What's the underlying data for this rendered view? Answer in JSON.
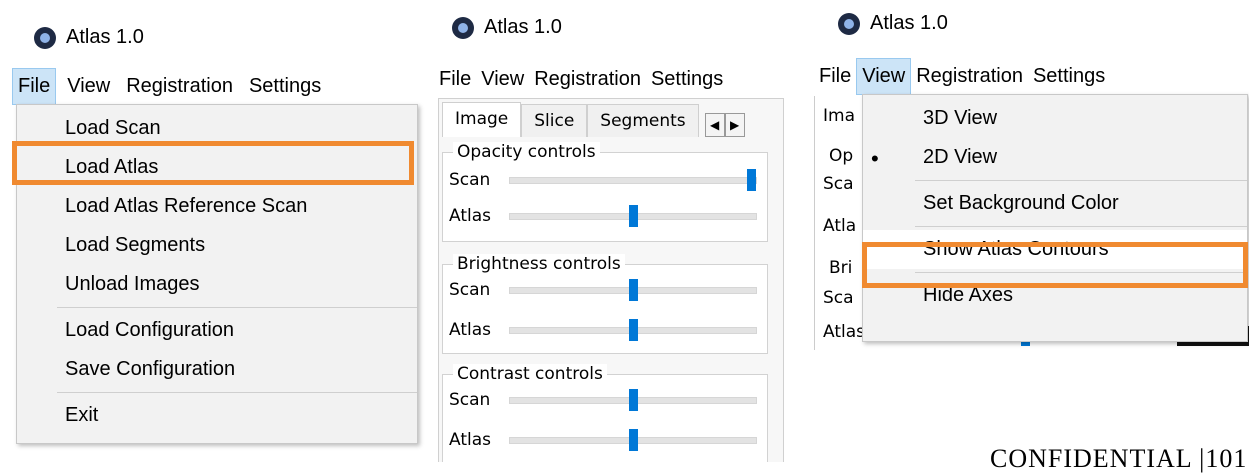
{
  "app_title": "Atlas 1.0",
  "menubar": [
    "File",
    "View",
    "Registration",
    "Settings"
  ],
  "file_menu": {
    "items": [
      "Load Scan",
      "Load Atlas",
      "Load Atlas Reference Scan",
      "Load Segments",
      "Unload Images",
      "Load Configuration",
      "Save Configuration",
      "Exit"
    ],
    "highlighted": "Load Atlas"
  },
  "tabs": [
    "Image",
    "Slice",
    "Segments"
  ],
  "tab_arrows": [
    "◀",
    "▶"
  ],
  "groups": [
    {
      "title": "Opacity controls",
      "rows": [
        {
          "label": "Scan",
          "value": 1.0
        },
        {
          "label": "Atlas",
          "value": 0.5
        }
      ]
    },
    {
      "title": "Brightness controls",
      "rows": [
        {
          "label": "Scan",
          "value": 0.5
        },
        {
          "label": "Atlas",
          "value": 0.5
        }
      ]
    },
    {
      "title": "Contrast controls",
      "rows": [
        {
          "label": "Scan",
          "value": 0.5
        },
        {
          "label": "Atlas",
          "value": 0.5
        }
      ]
    }
  ],
  "view_menu": {
    "items": [
      "3D View",
      "2D View",
      "Set Background Color",
      "Show Atlas Contours",
      "Hide Axes"
    ],
    "checked_mark": "•",
    "highlighted": "Show Atlas Contours"
  },
  "panel3_bg": {
    "tab_fragment": "Ima",
    "op_fragment": "Op",
    "scan_fragment": "Sca",
    "atlas_fragment": "Atla",
    "bri_fragment": "Bri",
    "scan2_fragment": "Sca",
    "atlas2_fragment": "Atlas"
  },
  "footer": "CONFIDENTIAL |101",
  "colors": {
    "highlight": "#f08a30",
    "slider_thumb": "#0078d7",
    "active_menu": "#cce4f7"
  }
}
